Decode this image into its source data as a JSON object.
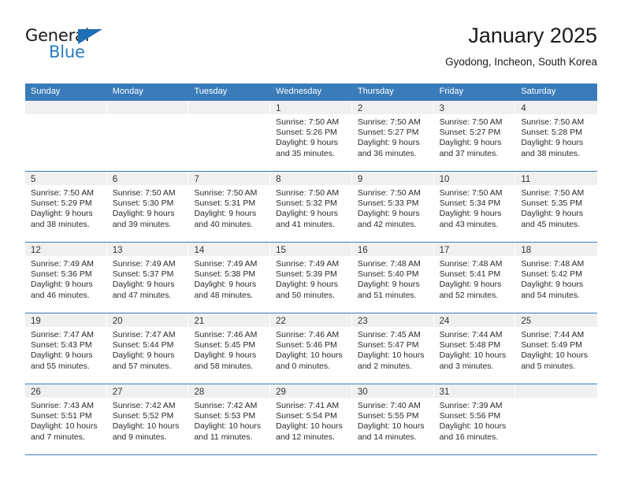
{
  "brand": {
    "name_top": "General",
    "name_bottom": "Blue",
    "accent_color": "#2a7ac0"
  },
  "header": {
    "title": "January 2025",
    "subtitle": "Gyodong, Incheon, South Korea"
  },
  "theme": {
    "header_blue": "#3a7cba",
    "daynum_band": "#f0f0f0",
    "text": "#2b2b2b"
  },
  "weekdays": [
    "Sunday",
    "Monday",
    "Tuesday",
    "Wednesday",
    "Thursday",
    "Friday",
    "Saturday"
  ],
  "labels": {
    "sunrise_prefix": "Sunrise:",
    "sunset_prefix": "Sunset:",
    "daylight_prefix": "Daylight:"
  },
  "weeks": [
    [
      {
        "day": "",
        "empty": true
      },
      {
        "day": "",
        "empty": true
      },
      {
        "day": "",
        "empty": true
      },
      {
        "day": "1",
        "sunrise": "Sunrise: 7:50 AM",
        "sunset": "Sunset: 5:26 PM",
        "daylight1": "Daylight: 9 hours",
        "daylight2": "and 35 minutes."
      },
      {
        "day": "2",
        "sunrise": "Sunrise: 7:50 AM",
        "sunset": "Sunset: 5:27 PM",
        "daylight1": "Daylight: 9 hours",
        "daylight2": "and 36 minutes."
      },
      {
        "day": "3",
        "sunrise": "Sunrise: 7:50 AM",
        "sunset": "Sunset: 5:27 PM",
        "daylight1": "Daylight: 9 hours",
        "daylight2": "and 37 minutes."
      },
      {
        "day": "4",
        "sunrise": "Sunrise: 7:50 AM",
        "sunset": "Sunset: 5:28 PM",
        "daylight1": "Daylight: 9 hours",
        "daylight2": "and 38 minutes."
      }
    ],
    [
      {
        "day": "5",
        "sunrise": "Sunrise: 7:50 AM",
        "sunset": "Sunset: 5:29 PM",
        "daylight1": "Daylight: 9 hours",
        "daylight2": "and 38 minutes."
      },
      {
        "day": "6",
        "sunrise": "Sunrise: 7:50 AM",
        "sunset": "Sunset: 5:30 PM",
        "daylight1": "Daylight: 9 hours",
        "daylight2": "and 39 minutes."
      },
      {
        "day": "7",
        "sunrise": "Sunrise: 7:50 AM",
        "sunset": "Sunset: 5:31 PM",
        "daylight1": "Daylight: 9 hours",
        "daylight2": "and 40 minutes."
      },
      {
        "day": "8",
        "sunrise": "Sunrise: 7:50 AM",
        "sunset": "Sunset: 5:32 PM",
        "daylight1": "Daylight: 9 hours",
        "daylight2": "and 41 minutes."
      },
      {
        "day": "9",
        "sunrise": "Sunrise: 7:50 AM",
        "sunset": "Sunset: 5:33 PM",
        "daylight1": "Daylight: 9 hours",
        "daylight2": "and 42 minutes."
      },
      {
        "day": "10",
        "sunrise": "Sunrise: 7:50 AM",
        "sunset": "Sunset: 5:34 PM",
        "daylight1": "Daylight: 9 hours",
        "daylight2": "and 43 minutes."
      },
      {
        "day": "11",
        "sunrise": "Sunrise: 7:50 AM",
        "sunset": "Sunset: 5:35 PM",
        "daylight1": "Daylight: 9 hours",
        "daylight2": "and 45 minutes."
      }
    ],
    [
      {
        "day": "12",
        "sunrise": "Sunrise: 7:49 AM",
        "sunset": "Sunset: 5:36 PM",
        "daylight1": "Daylight: 9 hours",
        "daylight2": "and 46 minutes."
      },
      {
        "day": "13",
        "sunrise": "Sunrise: 7:49 AM",
        "sunset": "Sunset: 5:37 PM",
        "daylight1": "Daylight: 9 hours",
        "daylight2": "and 47 minutes."
      },
      {
        "day": "14",
        "sunrise": "Sunrise: 7:49 AM",
        "sunset": "Sunset: 5:38 PM",
        "daylight1": "Daylight: 9 hours",
        "daylight2": "and 48 minutes."
      },
      {
        "day": "15",
        "sunrise": "Sunrise: 7:49 AM",
        "sunset": "Sunset: 5:39 PM",
        "daylight1": "Daylight: 9 hours",
        "daylight2": "and 50 minutes."
      },
      {
        "day": "16",
        "sunrise": "Sunrise: 7:48 AM",
        "sunset": "Sunset: 5:40 PM",
        "daylight1": "Daylight: 9 hours",
        "daylight2": "and 51 minutes."
      },
      {
        "day": "17",
        "sunrise": "Sunrise: 7:48 AM",
        "sunset": "Sunset: 5:41 PM",
        "daylight1": "Daylight: 9 hours",
        "daylight2": "and 52 minutes."
      },
      {
        "day": "18",
        "sunrise": "Sunrise: 7:48 AM",
        "sunset": "Sunset: 5:42 PM",
        "daylight1": "Daylight: 9 hours",
        "daylight2": "and 54 minutes."
      }
    ],
    [
      {
        "day": "19",
        "sunrise": "Sunrise: 7:47 AM",
        "sunset": "Sunset: 5:43 PM",
        "daylight1": "Daylight: 9 hours",
        "daylight2": "and 55 minutes."
      },
      {
        "day": "20",
        "sunrise": "Sunrise: 7:47 AM",
        "sunset": "Sunset: 5:44 PM",
        "daylight1": "Daylight: 9 hours",
        "daylight2": "and 57 minutes."
      },
      {
        "day": "21",
        "sunrise": "Sunrise: 7:46 AM",
        "sunset": "Sunset: 5:45 PM",
        "daylight1": "Daylight: 9 hours",
        "daylight2": "and 58 minutes."
      },
      {
        "day": "22",
        "sunrise": "Sunrise: 7:46 AM",
        "sunset": "Sunset: 5:46 PM",
        "daylight1": "Daylight: 10 hours",
        "daylight2": "and 0 minutes."
      },
      {
        "day": "23",
        "sunrise": "Sunrise: 7:45 AM",
        "sunset": "Sunset: 5:47 PM",
        "daylight1": "Daylight: 10 hours",
        "daylight2": "and 2 minutes."
      },
      {
        "day": "24",
        "sunrise": "Sunrise: 7:44 AM",
        "sunset": "Sunset: 5:48 PM",
        "daylight1": "Daylight: 10 hours",
        "daylight2": "and 3 minutes."
      },
      {
        "day": "25",
        "sunrise": "Sunrise: 7:44 AM",
        "sunset": "Sunset: 5:49 PM",
        "daylight1": "Daylight: 10 hours",
        "daylight2": "and 5 minutes."
      }
    ],
    [
      {
        "day": "26",
        "sunrise": "Sunrise: 7:43 AM",
        "sunset": "Sunset: 5:51 PM",
        "daylight1": "Daylight: 10 hours",
        "daylight2": "and 7 minutes."
      },
      {
        "day": "27",
        "sunrise": "Sunrise: 7:42 AM",
        "sunset": "Sunset: 5:52 PM",
        "daylight1": "Daylight: 10 hours",
        "daylight2": "and 9 minutes."
      },
      {
        "day": "28",
        "sunrise": "Sunrise: 7:42 AM",
        "sunset": "Sunset: 5:53 PM",
        "daylight1": "Daylight: 10 hours",
        "daylight2": "and 11 minutes."
      },
      {
        "day": "29",
        "sunrise": "Sunrise: 7:41 AM",
        "sunset": "Sunset: 5:54 PM",
        "daylight1": "Daylight: 10 hours",
        "daylight2": "and 12 minutes."
      },
      {
        "day": "30",
        "sunrise": "Sunrise: 7:40 AM",
        "sunset": "Sunset: 5:55 PM",
        "daylight1": "Daylight: 10 hours",
        "daylight2": "and 14 minutes."
      },
      {
        "day": "31",
        "sunrise": "Sunrise: 7:39 AM",
        "sunset": "Sunset: 5:56 PM",
        "daylight1": "Daylight: 10 hours",
        "daylight2": "and 16 minutes."
      },
      {
        "day": "",
        "empty": true
      }
    ]
  ]
}
